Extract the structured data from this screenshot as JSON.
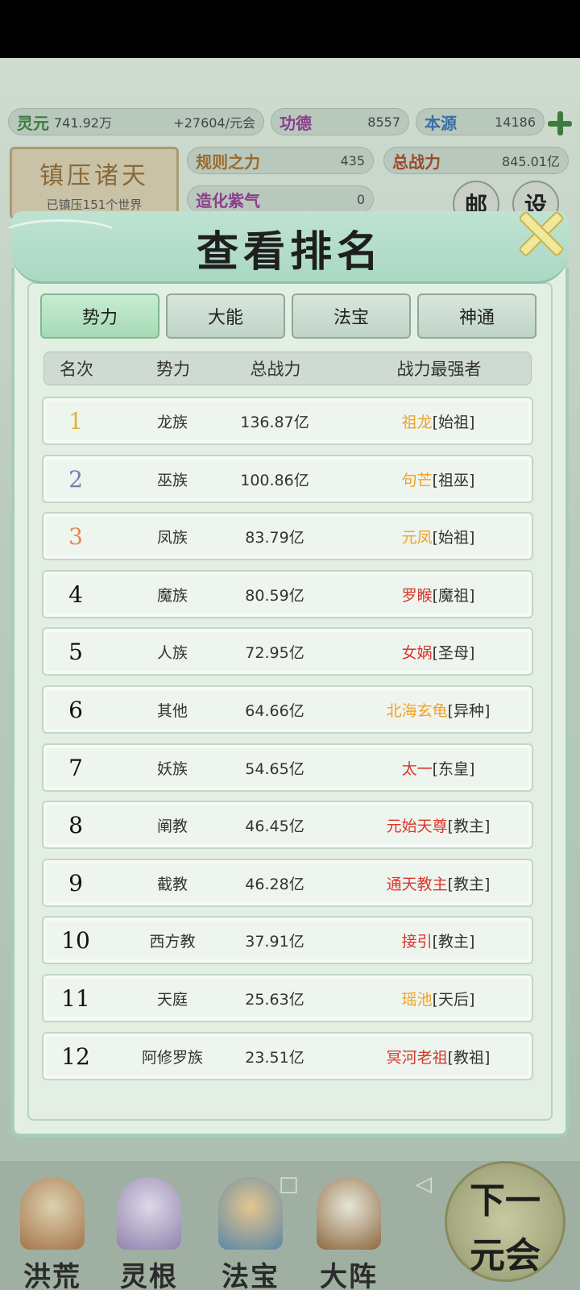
{
  "resources": {
    "lingyuan_label": "灵元",
    "lingyuan_value": "741.92万",
    "lingyuan_rate": "+27604/元会",
    "gongde_label": "功德",
    "gongde_value": "8557",
    "benyuan_label": "本源",
    "benyuan_value": "14186",
    "guize_label": "规则之力",
    "guize_value": "435",
    "zongzhanli_label": "总战力",
    "zongzhanli_value": "845.01亿",
    "hidden_label": "造化紫气",
    "hidden_value": "0"
  },
  "suppress": {
    "title": "镇压诸天",
    "subtitle": "已镇压151个世界"
  },
  "side_buttons": {
    "mail": "邮",
    "settings": "设"
  },
  "modal": {
    "title": "查看排名",
    "tabs": [
      {
        "label": "势力",
        "active": true
      },
      {
        "label": "大能",
        "active": false
      },
      {
        "label": "法宝",
        "active": false
      },
      {
        "label": "神通",
        "active": false
      }
    ],
    "columns": {
      "rank": "名次",
      "faction": "势力",
      "power": "总战力",
      "strongest": "战力最强者"
    },
    "rows": [
      {
        "rank": "1",
        "faction": "龙族",
        "power": "136.87亿",
        "name": "祖龙",
        "tag": "[始祖]",
        "name_color": "orange"
      },
      {
        "rank": "2",
        "faction": "巫族",
        "power": "100.86亿",
        "name": "句芒",
        "tag": "[祖巫]",
        "name_color": "orange"
      },
      {
        "rank": "3",
        "faction": "凤族",
        "power": "83.79亿",
        "name": "元凤",
        "tag": "[始祖]",
        "name_color": "orange"
      },
      {
        "rank": "4",
        "faction": "魔族",
        "power": "80.59亿",
        "name": "罗睺",
        "tag": "[魔祖]",
        "name_color": "red"
      },
      {
        "rank": "5",
        "faction": "人族",
        "power": "72.95亿",
        "name": "女娲",
        "tag": "[圣母]",
        "name_color": "red"
      },
      {
        "rank": "6",
        "faction": "其他",
        "power": "64.66亿",
        "name": "北海玄龟",
        "tag": "[异种]",
        "name_color": "orange"
      },
      {
        "rank": "7",
        "faction": "妖族",
        "power": "54.65亿",
        "name": "太一",
        "tag": "[东皇]",
        "name_color": "red"
      },
      {
        "rank": "8",
        "faction": "阐教",
        "power": "46.45亿",
        "name": "元始天尊",
        "tag": "[教主]",
        "name_color": "red"
      },
      {
        "rank": "9",
        "faction": "截教",
        "power": "46.28亿",
        "name": "通天教主",
        "tag": "[教主]",
        "name_color": "red"
      },
      {
        "rank": "10",
        "faction": "西方教",
        "power": "37.91亿",
        "name": "接引",
        "tag": "[教主]",
        "name_color": "red"
      },
      {
        "rank": "11",
        "faction": "天庭",
        "power": "25.63亿",
        "name": "瑶池",
        "tag": "[天后]",
        "name_color": "orange"
      },
      {
        "rank": "12",
        "faction": "阿修罗族",
        "power": "23.51亿",
        "name": "冥河老祖",
        "tag": "[教祖]",
        "name_color": "red"
      }
    ]
  },
  "bottom_nav": [
    {
      "label": "洪荒",
      "icon": "mountain-icon"
    },
    {
      "label": "灵根",
      "icon": "lotus-icon"
    },
    {
      "label": "法宝",
      "icon": "treasure-icon"
    },
    {
      "label": "大阵",
      "icon": "taiji-icon"
    }
  ],
  "next_era": {
    "line1": "下一",
    "line2": "元会"
  }
}
